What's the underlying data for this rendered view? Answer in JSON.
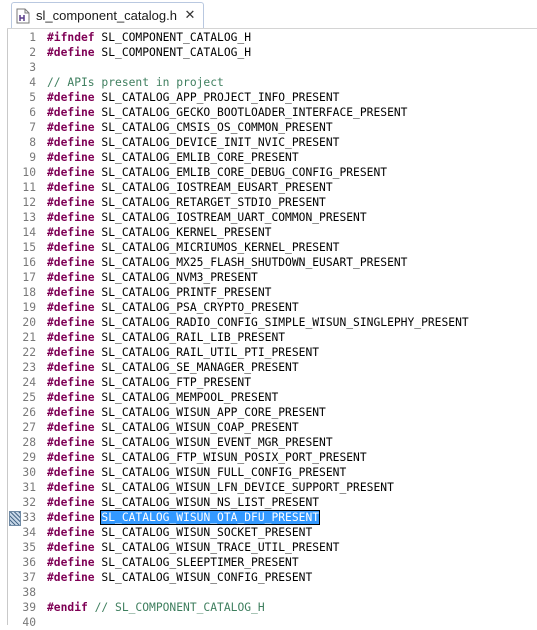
{
  "tab": {
    "label": "sl_component_catalog.h",
    "file_icon": "header-file-icon",
    "close_icon": "close-icon",
    "close_glyph": "✕"
  },
  "editor": {
    "lines": [
      {
        "num": "1",
        "kw": "#ifndef",
        "rest": " SL_COMPONENT_CATALOG_H"
      },
      {
        "num": "2",
        "kw": "#define",
        "rest": " SL_COMPONENT_CATALOG_H"
      },
      {
        "num": "3"
      },
      {
        "num": "4",
        "comment": "// APIs present in project"
      },
      {
        "num": "5",
        "kw": "#define",
        "rest": " SL_CATALOG_APP_PROJECT_INFO_PRESENT"
      },
      {
        "num": "6",
        "kw": "#define",
        "rest": " SL_CATALOG_GECKO_BOOTLOADER_INTERFACE_PRESENT"
      },
      {
        "num": "7",
        "kw": "#define",
        "rest": " SL_CATALOG_CMSIS_OS_COMMON_PRESENT"
      },
      {
        "num": "8",
        "kw": "#define",
        "rest": " SL_CATALOG_DEVICE_INIT_NVIC_PRESENT"
      },
      {
        "num": "9",
        "kw": "#define",
        "rest": " SL_CATALOG_EMLIB_CORE_PRESENT"
      },
      {
        "num": "10",
        "kw": "#define",
        "rest": " SL_CATALOG_EMLIB_CORE_DEBUG_CONFIG_PRESENT"
      },
      {
        "num": "11",
        "kw": "#define",
        "rest": " SL_CATALOG_IOSTREAM_EUSART_PRESENT"
      },
      {
        "num": "12",
        "kw": "#define",
        "rest": " SL_CATALOG_RETARGET_STDIO_PRESENT"
      },
      {
        "num": "13",
        "kw": "#define",
        "rest": " SL_CATALOG_IOSTREAM_UART_COMMON_PRESENT"
      },
      {
        "num": "14",
        "kw": "#define",
        "rest": " SL_CATALOG_KERNEL_PRESENT"
      },
      {
        "num": "15",
        "kw": "#define",
        "rest": " SL_CATALOG_MICRIUMOS_KERNEL_PRESENT"
      },
      {
        "num": "16",
        "kw": "#define",
        "rest": " SL_CATALOG_MX25_FLASH_SHUTDOWN_EUSART_PRESENT"
      },
      {
        "num": "17",
        "kw": "#define",
        "rest": " SL_CATALOG_NVM3_PRESENT"
      },
      {
        "num": "18",
        "kw": "#define",
        "rest": " SL_CATALOG_PRINTF_PRESENT"
      },
      {
        "num": "19",
        "kw": "#define",
        "rest": " SL_CATALOG_PSA_CRYPTO_PRESENT"
      },
      {
        "num": "20",
        "kw": "#define",
        "rest": " SL_CATALOG_RADIO_CONFIG_SIMPLE_WISUN_SINGLEPHY_PRESENT"
      },
      {
        "num": "21",
        "kw": "#define",
        "rest": " SL_CATALOG_RAIL_LIB_PRESENT"
      },
      {
        "num": "22",
        "kw": "#define",
        "rest": " SL_CATALOG_RAIL_UTIL_PTI_PRESENT"
      },
      {
        "num": "23",
        "kw": "#define",
        "rest": " SL_CATALOG_SE_MANAGER_PRESENT"
      },
      {
        "num": "24",
        "kw": "#define",
        "rest": " SL_CATALOG_FTP_PRESENT"
      },
      {
        "num": "25",
        "kw": "#define",
        "rest": " SL_CATALOG_MEMPOOL_PRESENT"
      },
      {
        "num": "26",
        "kw": "#define",
        "rest": " SL_CATALOG_WISUN_APP_CORE_PRESENT"
      },
      {
        "num": "27",
        "kw": "#define",
        "rest": " SL_CATALOG_WISUN_COAP_PRESENT"
      },
      {
        "num": "28",
        "kw": "#define",
        "rest": " SL_CATALOG_WISUN_EVENT_MGR_PRESENT"
      },
      {
        "num": "29",
        "kw": "#define",
        "rest": " SL_CATALOG_FTP_WISUN_POSIX_PORT_PRESENT"
      },
      {
        "num": "30",
        "kw": "#define",
        "rest": " SL_CATALOG_WISUN_FULL_CONFIG_PRESENT"
      },
      {
        "num": "31",
        "kw": "#define",
        "rest": " SL_CATALOG_WISUN_LFN_DEVICE_SUPPORT_PRESENT"
      },
      {
        "num": "32",
        "kw": "#define",
        "rest": " SL_CATALOG_WISUN_NS_LIST_PRESENT"
      },
      {
        "num": "33",
        "kw": "#define",
        "rest": " ",
        "selected": "SL_CATALOG_WISUN_OTA_DFU_PRESENT",
        "marker": true
      },
      {
        "num": "34",
        "kw": "#define",
        "rest": " SL_CATALOG_WISUN_SOCKET_PRESENT"
      },
      {
        "num": "35",
        "kw": "#define",
        "rest": " SL_CATALOG_WISUN_TRACE_UTIL_PRESENT"
      },
      {
        "num": "36",
        "kw": "#define",
        "rest": " SL_CATALOG_SLEEPTIMER_PRESENT"
      },
      {
        "num": "37",
        "kw": "#define",
        "rest": " SL_CATALOG_WISUN_CONFIG_PRESENT"
      },
      {
        "num": "38"
      },
      {
        "num": "39",
        "kw": "#endif",
        "comment": " // SL_COMPONENT_CATALOG_H"
      },
      {
        "num": "40"
      }
    ]
  }
}
